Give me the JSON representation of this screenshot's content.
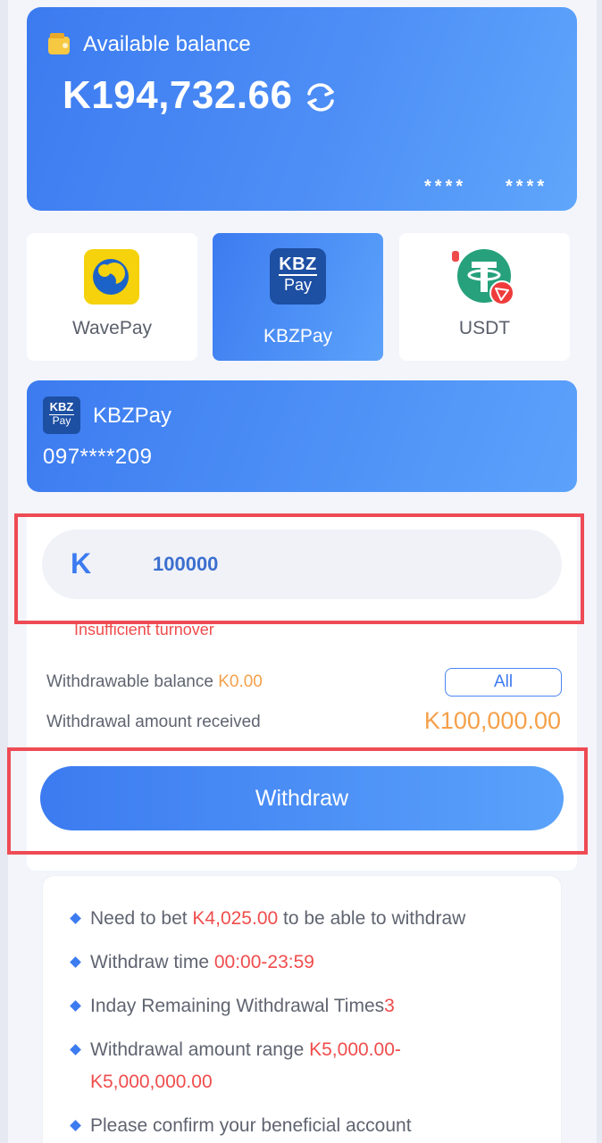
{
  "colors": {
    "primary": "#3c7bf0",
    "accent_orange": "#f5a04a",
    "error_red": "#f04c4c",
    "highlight_box": "#ee4b55"
  },
  "balance_card": {
    "label": "Available balance",
    "amount": "K194,732.66",
    "mask_1": "****",
    "mask_2": "****",
    "icons": [
      "wallet-icon",
      "refresh-icon"
    ]
  },
  "methods": [
    {
      "label": "WavePay",
      "icon": "wavepay-logo-icon",
      "selected": false
    },
    {
      "label": "KBZPay",
      "icon": "kbzpay-logo-icon",
      "selected": true,
      "logo_top": "KBZ",
      "logo_bottom": "Pay"
    },
    {
      "label": "USDT",
      "icon": "usdt-logo-icon",
      "selected": false
    }
  ],
  "account": {
    "name": "KBZPay",
    "number": "097****209",
    "logo_top": "KBZ",
    "logo_bottom": "Pay"
  },
  "form": {
    "currency": "K",
    "amount_value": "100000",
    "error": "Insufficient turnover",
    "withdrawable_label": "Withdrawable balance ",
    "withdrawable_value": "K0.00",
    "all_label": "All",
    "received_label": "Withdrawal amount received",
    "received_value": "K100,000.00",
    "withdraw_label": "Withdraw"
  },
  "notes": [
    {
      "prefix": "Need to bet ",
      "highlight": "K4,025.00",
      "suffix": " to be able to withdraw"
    },
    {
      "prefix": "Withdraw time ",
      "highlight": "00:00-23:59",
      "suffix": ""
    },
    {
      "prefix": "Inday Remaining Withdrawal Times",
      "highlight": "3",
      "suffix": ""
    },
    {
      "prefix": "Withdrawal amount range ",
      "highlight": "K5,000.00-",
      "suffix": "",
      "line2": "K5,000,000.00"
    },
    {
      "prefix": "Please confirm your beneficial account",
      "highlight": "",
      "suffix": ""
    }
  ]
}
